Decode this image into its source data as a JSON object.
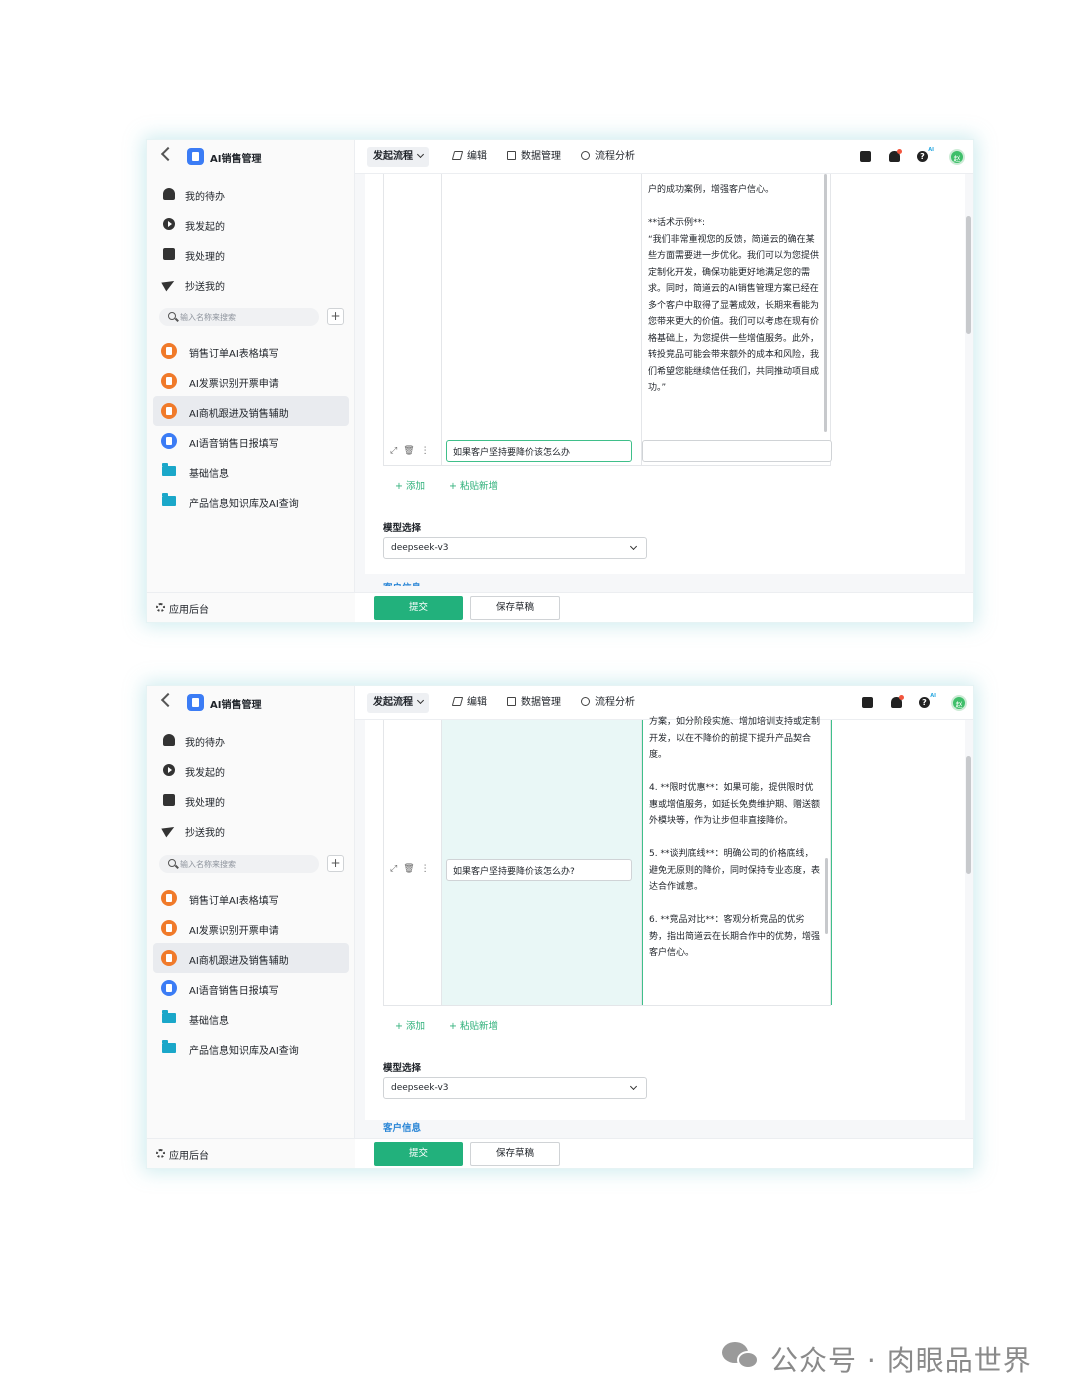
{
  "app": {
    "title": "AI销售管理",
    "nav": [
      "我的待办",
      "我发起的",
      "我处理的",
      "抄送我的"
    ],
    "search_placeholder": "输入名称来搜索",
    "add_label": "+",
    "forms": [
      "销售订单AI表格填写",
      "AI发票识别开票申请",
      "AI商机跟进及销售辅助",
      "AI语音销售日报填写",
      "基础信息",
      "产品信息知识库及AI查询"
    ],
    "active_form": "AI商机跟进及销售辅助",
    "footer": "应用后台"
  },
  "toolbar": {
    "launch": "发起流程",
    "edit": "编辑",
    "data_manage": "数据管理",
    "flow_analysis": "流程分析",
    "avatar": "赵"
  },
  "shot1": {
    "answer_text": "户的成功案例，增强客户信心。\n\n**话术示例**:\n“我们非常重视您的反馈，简道云的确在某些方面需要进一步优化。我们可以为您提供定制化开发，确保功能更好地满足您的需求。同时，简道云的AI销售管理方案已经在多个客户中取得了显著成效，长期来看能为您带来更大的价值。我们可以考虑在现有价格基础上，为您提供一些增值服务。此外，转投竞品可能会带来额外的成本和风险，我们希望您能继续信任我们，共同推动项目成功。”",
    "question": "如果客户坚持要降价该怎么办"
  },
  "shot2": {
    "answer_text": "方案，如分阶段实施、增加培训支持或定制开发，以在不降价的前提下提升产品契合度。\n\n4. **限时优惠**：如果可能，提供限时优惠或增值服务，如延长免费维护期、赠送额外模块等，作为让步但非直接降价。\n\n5. **谈判底线**：明确公司的价格底线，避免无原则的降价，同时保持专业态度，表达合作诚意。\n\n6. **竞品对比**：客观分析竞品的优劣势，指出简道云在长期合作中的优势，增强客户信心。",
    "question": "如果客户坚持要降价该怎么办?"
  },
  "form": {
    "add": "添加",
    "paste_add": "粘贴新增",
    "model_label": "模型选择",
    "model_value": "deepseek-v3",
    "customer_info": "客户信息",
    "submit": "提交",
    "save_draft": "保存草稿"
  },
  "watermark": "公众号 · 肉眼品世界",
  "colors": {
    "accent_green": "#22b17c",
    "brand_blue": "#3b7cf5",
    "folder_teal": "#1aa7c9",
    "form_icon_orange": "#f07a2a",
    "tinted_cell": "#e9f7f6"
  }
}
